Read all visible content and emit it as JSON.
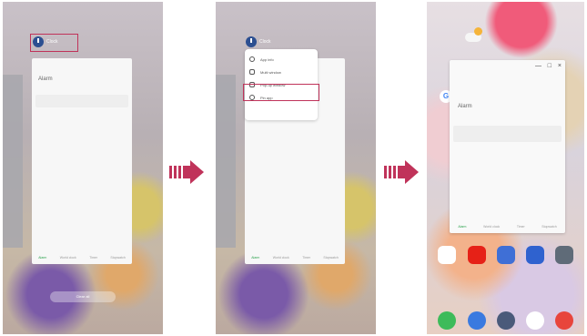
{
  "panel1": {
    "clock_label": "Clock",
    "card_title": "Alarm",
    "tabs": [
      "Alarm",
      "World clock",
      "Timer",
      "Stopwatch"
    ],
    "recent_button": "Clear all"
  },
  "panel2": {
    "clock_label": "Clock",
    "menu_items": [
      "App info",
      "Multi window",
      "Pop-up window",
      "Pin app"
    ],
    "tabs": [
      "Alarm",
      "World clock",
      "Timer",
      "Stopwatch"
    ]
  },
  "panel3": {
    "card_title": "Alarm",
    "tabs": [
      "Alarm",
      "World clock",
      "Timer",
      "Stopwatch"
    ],
    "window_controls": [
      "—",
      "□",
      "×"
    ]
  },
  "colors": {
    "highlight": "#c0335a",
    "arrow": "#c0335a",
    "clock_icon": "#2c4f91",
    "active_tab": "#2ea44f"
  },
  "icons": {
    "arrow": "right-arrow-icon",
    "clock": "clock-icon",
    "weather": "weather-icon",
    "google": "google-icon"
  }
}
